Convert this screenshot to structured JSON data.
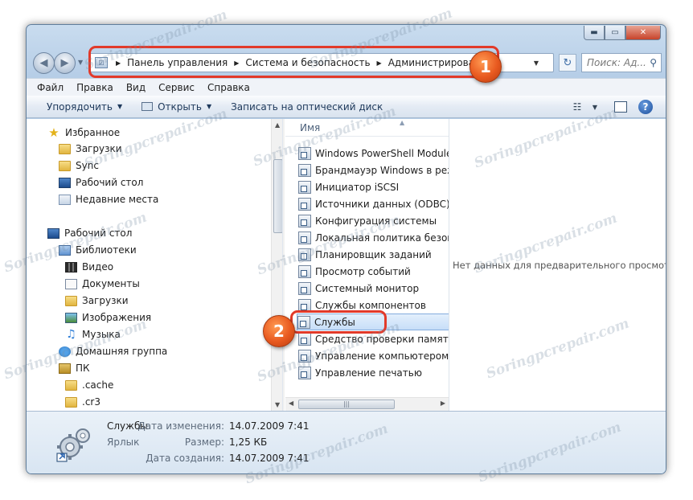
{
  "window": {
    "caption_buttons": {
      "minimize": "▬",
      "maximize": "▭",
      "close": "✕"
    }
  },
  "nav": {
    "back_glyph": "◀",
    "forward_glyph": "▶",
    "breadcrumbs": [
      "Панель управления",
      "Система и безопасность",
      "Администрирование"
    ],
    "search_placeholder": "Поиск: Ад...",
    "refresh_glyph": "↻"
  },
  "menu": [
    "Файл",
    "Правка",
    "Вид",
    "Сервис",
    "Справка"
  ],
  "toolbar": {
    "organize": "Упорядочить",
    "open": "Открыть",
    "burn": "Записать на оптический диск"
  },
  "navigation_pane": {
    "items": [
      {
        "label": "Избранное",
        "icon": "star-icon",
        "level": 0,
        "group_top": true
      },
      {
        "label": "Загрузки",
        "icon": "downloads-folder-icon",
        "level": 1
      },
      {
        "label": "Sync",
        "icon": "folder-icon",
        "level": 1
      },
      {
        "label": "Рабочий стол",
        "icon": "desktop-icon",
        "level": 1
      },
      {
        "label": "Недавние места",
        "icon": "recent-places-icon",
        "level": 1
      },
      {
        "label": "Рабочий стол",
        "icon": "desktop-icon",
        "level": 0,
        "group_top": true
      },
      {
        "label": "Библиотеки",
        "icon": "libraries-icon",
        "level": 1
      },
      {
        "label": "Видео",
        "icon": "video-icon",
        "level": 2
      },
      {
        "label": "Документы",
        "icon": "documents-icon",
        "level": 2
      },
      {
        "label": "Загрузки",
        "icon": "downloads-icon",
        "level": 2
      },
      {
        "label": "Изображения",
        "icon": "pictures-icon",
        "level": 2
      },
      {
        "label": "Музыка",
        "icon": "music-icon",
        "level": 2
      },
      {
        "label": "Домашняя группа",
        "icon": "homegroup-icon",
        "level": 1
      },
      {
        "label": "ПК",
        "icon": "computer-icon",
        "level": 1
      },
      {
        "label": ".cache",
        "icon": "folder-icon",
        "level": 2
      },
      {
        "label": ".cr3",
        "icon": "folder-icon",
        "level": 2
      }
    ]
  },
  "file_list": {
    "column_name": "Имя",
    "items": [
      "Windows PowerShell Modules",
      "Брандмауэр Windows в режим",
      "Инициатор iSCSI",
      "Источники данных (ODBC)",
      "Конфигурация системы",
      "Локальная политика безопас",
      "Планировщик заданий",
      "Просмотр событий",
      "Системный монитор",
      "Службы компонентов",
      "Службы",
      "Средство проверки памяти W",
      "Управление компьютером",
      "Управление печатью"
    ],
    "selected_index": 10
  },
  "preview": {
    "message": "Нет данных для предварительного просмотра."
  },
  "details": {
    "name": "Службы",
    "type": "Ярлык",
    "modified_label": "Дата изменения:",
    "modified_value": "14.07.2009 7:41",
    "size_label": "Размер:",
    "size_value": "1,25 КБ",
    "created_label": "Дата создания:",
    "created_value": "14.07.2009 7:41"
  },
  "annotations": {
    "badge1": "1",
    "badge2": "2",
    "accent_color": "#e23a2a"
  },
  "watermark": "Soringpcrepair.com"
}
